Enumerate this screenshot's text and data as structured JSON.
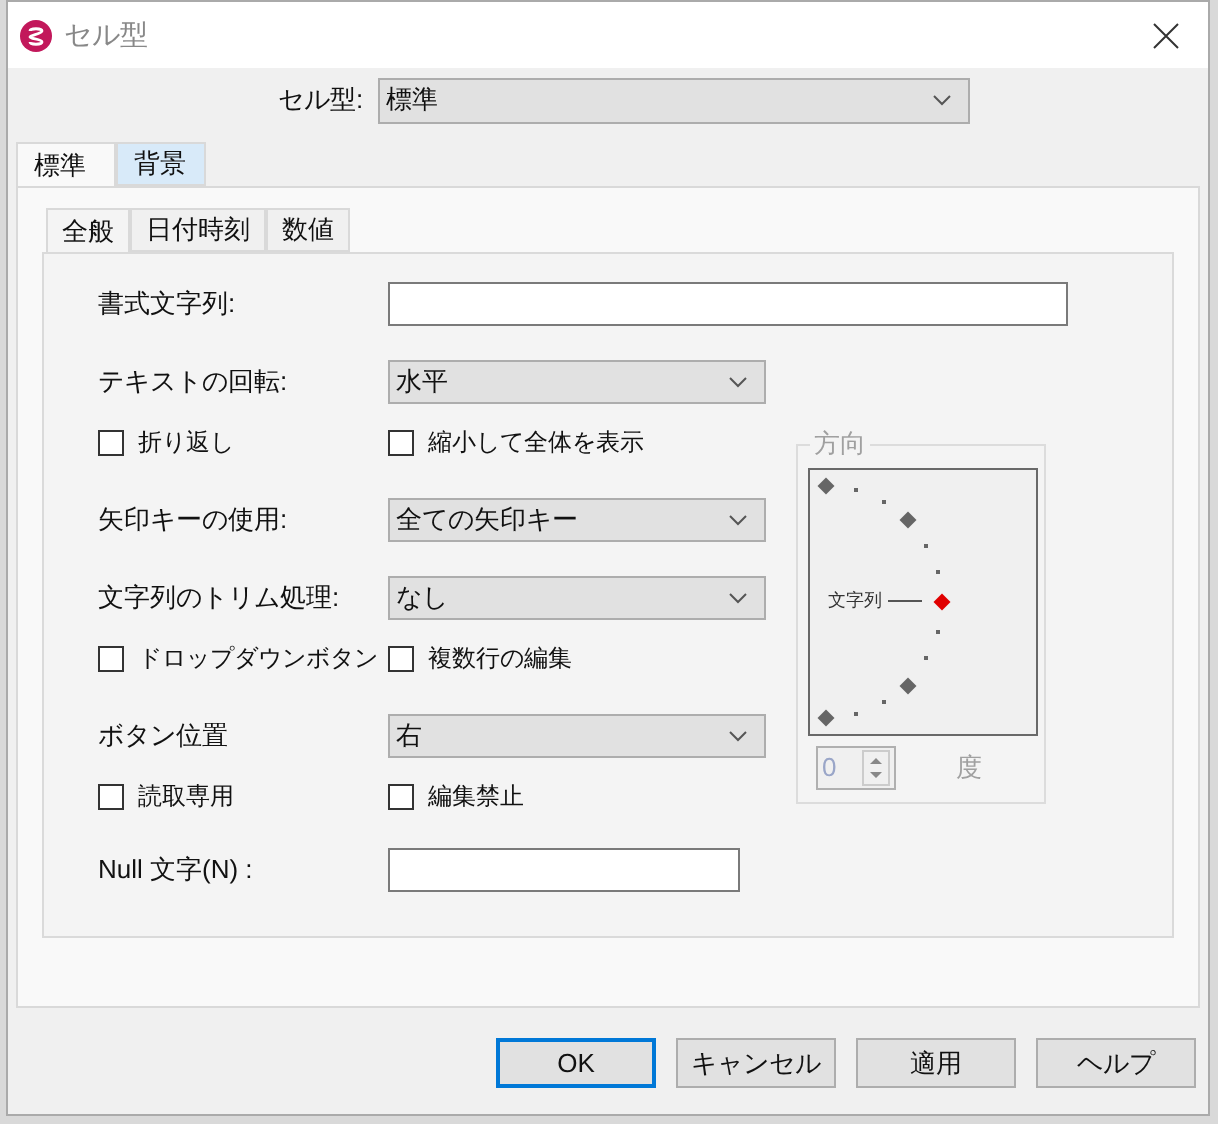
{
  "window": {
    "title": "セル型"
  },
  "cell_type": {
    "label": "セル型:",
    "value": "標準"
  },
  "outer_tabs": [
    {
      "label": "標準",
      "selected": true
    },
    {
      "label": "背景",
      "selected": false
    }
  ],
  "inner_tabs": [
    {
      "label": "全般",
      "selected": true
    },
    {
      "label": "日付時刻",
      "selected": false
    },
    {
      "label": "数値",
      "selected": false
    }
  ],
  "format_row": {
    "label": "書式文字列:"
  },
  "rows": [
    {
      "kind": "select",
      "label": "テキストの回転:",
      "value": "水平"
    },
    {
      "kind": "checks",
      "items": [
        {
          "label": "折り返し",
          "checked": false
        },
        {
          "label": "縮小して全体を表示",
          "checked": false
        }
      ]
    },
    {
      "kind": "select",
      "label": "矢印キーの使用:",
      "value": "全ての矢印キー"
    },
    {
      "kind": "select",
      "label": "文字列のトリム処理:",
      "value": "なし"
    },
    {
      "kind": "checks",
      "items": [
        {
          "label": "ドロップダウンボタン",
          "checked": false
        },
        {
          "label": "複数行の編集",
          "checked": false
        }
      ]
    },
    {
      "kind": "select",
      "label": "ボタン位置",
      "value": "右"
    },
    {
      "kind": "checks",
      "items": [
        {
          "label": "読取専用",
          "checked": false
        },
        {
          "label": "編集禁止",
          "checked": false
        }
      ]
    },
    {
      "kind": "text",
      "label": "Null 文字(N) :"
    }
  ],
  "direction": {
    "legend": "方向",
    "sample": "文字列",
    "degrees": "0",
    "unit": "度",
    "disabled": true
  },
  "buttons": [
    {
      "label": "OK",
      "default": true
    },
    {
      "label": "キャンセル",
      "default": false
    },
    {
      "label": "適用",
      "default": false
    },
    {
      "label": "ヘルプ",
      "default": false
    }
  ]
}
